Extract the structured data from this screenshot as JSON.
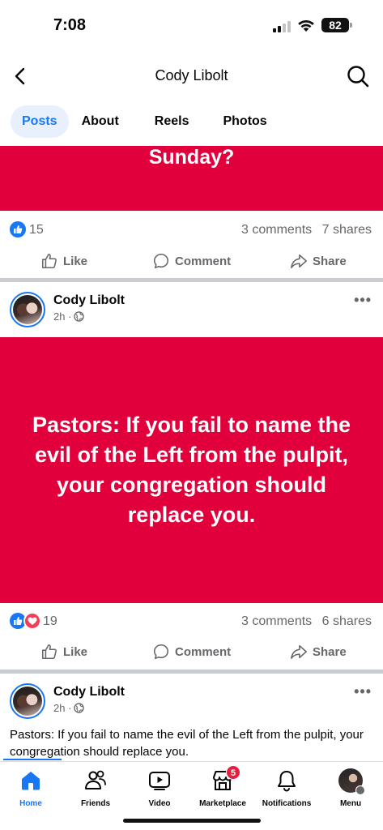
{
  "status_bar": {
    "time": "7:08",
    "battery": "82"
  },
  "header": {
    "title": "Cody Libolt"
  },
  "tabs": [
    {
      "label": "Posts",
      "active": true
    },
    {
      "label": "About",
      "active": false
    },
    {
      "label": "Reels",
      "active": false
    },
    {
      "label": "Photos",
      "active": false
    }
  ],
  "post1": {
    "banner_text": "Sunday?",
    "reaction_count": "15",
    "comments": "3 comments",
    "shares": "7 shares"
  },
  "actions": {
    "like": "Like",
    "comment": "Comment",
    "share": "Share"
  },
  "post2": {
    "author": "Cody Libolt",
    "time": "2h ·",
    "banner_text": "Pastors: If you fail to name the evil of the Left from the pulpit, your congregation should replace you.",
    "reaction_count": "19",
    "comments": "3 comments",
    "shares": "6 shares"
  },
  "post3": {
    "author": "Cody Libolt",
    "time": "2h ·",
    "text": "Pastors: If you fail to name the evil of the Left from the pulpit, your congregation should replace you."
  },
  "bottom_nav": [
    {
      "label": "Home",
      "icon": "home-icon",
      "active": true
    },
    {
      "label": "Friends",
      "icon": "friends-icon"
    },
    {
      "label": "Video",
      "icon": "video-icon"
    },
    {
      "label": "Marketplace",
      "icon": "marketplace-icon",
      "badge": "5"
    },
    {
      "label": "Notifications",
      "icon": "bell-icon"
    },
    {
      "label": "Menu",
      "icon": "avatar"
    }
  ],
  "colors": {
    "accent": "#1877f2",
    "banner": "#e1003b",
    "like_blue": "#1877f2",
    "love_red": "#f33e58",
    "badge_red": "#e41e3f"
  }
}
